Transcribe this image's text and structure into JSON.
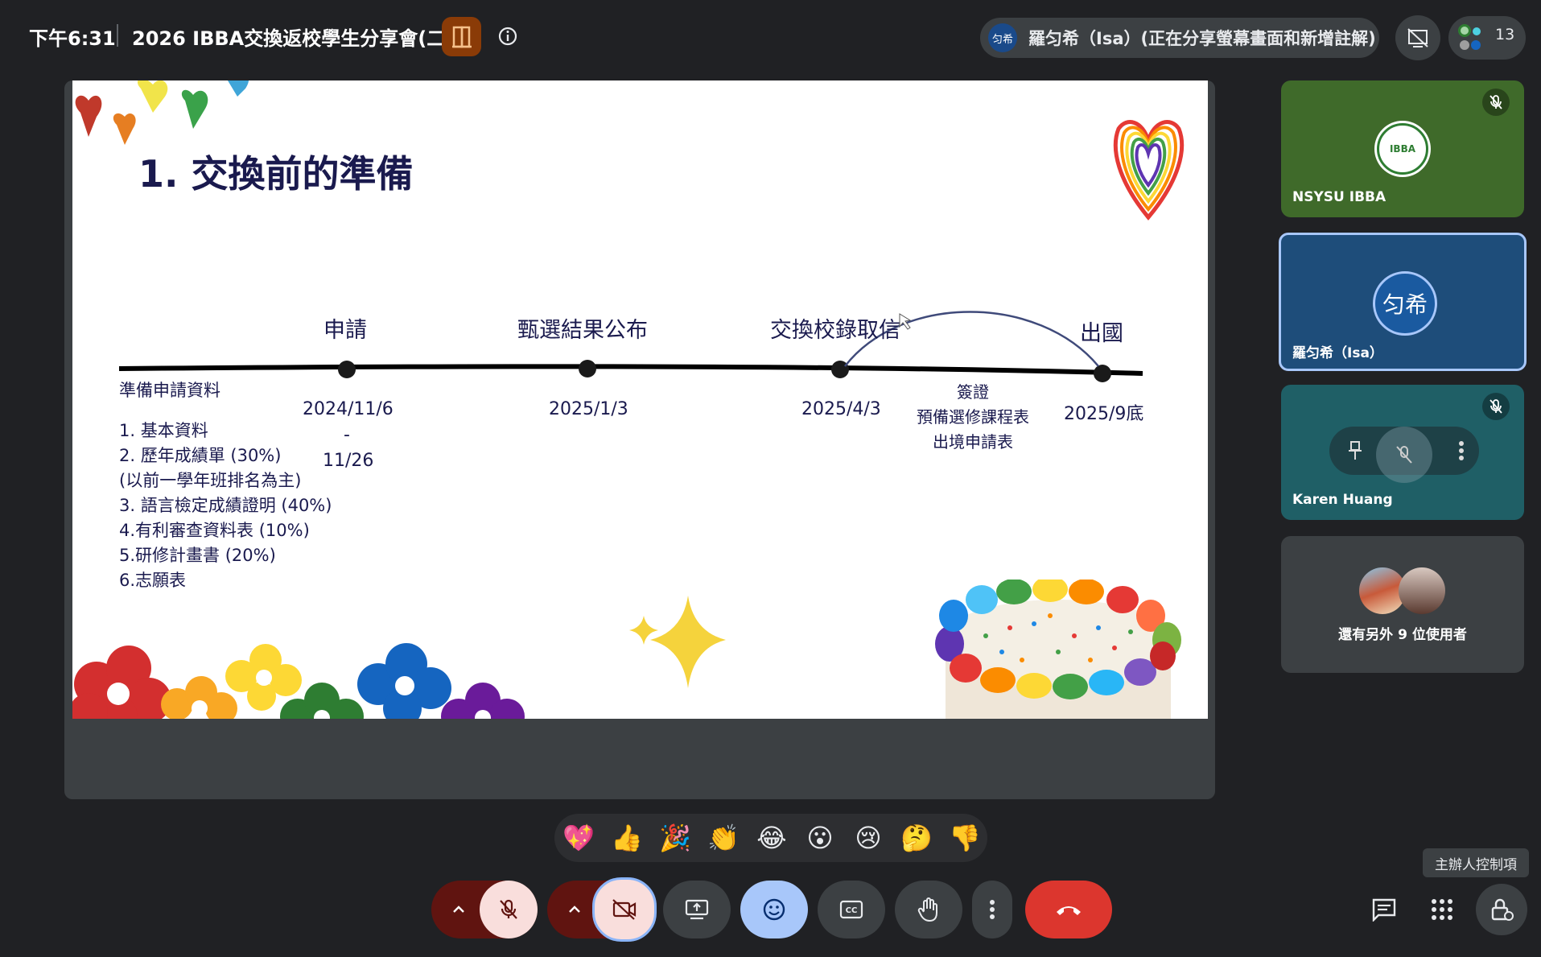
{
  "topbar": {
    "time": "下午6:31",
    "meeting_title": "2026 IBBA交換返校學生分享會(二)",
    "presenter_avatar": "匀希",
    "presenter_text": "羅匀希（Isa）(正在分享螢幕畫面和新增註解)",
    "participant_count": "13"
  },
  "slide": {
    "title": "1.  交換前的準備",
    "milestones": [
      {
        "label": "申請",
        "date": "2024/11/6"
      },
      {
        "label": "甄選結果公布",
        "date": "2025/1/3"
      },
      {
        "label": "交換校錄取信",
        "date": "2025/4/3"
      },
      {
        "label": "出國",
        "date": "2025/9底"
      }
    ],
    "date_range_dash": "-",
    "date_range_end": "11/26",
    "between_notes": [
      "簽證",
      "預備選修課程表",
      "出境申請表"
    ],
    "requirements_header": "準備申請資料",
    "requirements": [
      "1. 基本資料",
      "2. 歷年成績單 (30%)",
      "(以前一學年班排名為主)",
      "3. 語言檢定成績證明 (40%)",
      "4.有利審查資料表 (10%)",
      "5.研修計畫書 (20%)",
      "6.志願表"
    ],
    "badge_text": "IBBA"
  },
  "tiles": [
    {
      "name": "NSYSU IBBA",
      "color": "#3f6a2a"
    },
    {
      "name": "羅匀希（Isa）",
      "avatar": "匀希",
      "color": "#1e4d7a"
    },
    {
      "name": "Karen Huang",
      "color": "#1f5f66"
    },
    {
      "name": "還有另外 9 位使用者",
      "color": "#3c4043"
    }
  ],
  "reactions": [
    "💖",
    "👍",
    "🎉",
    "👏",
    "😂",
    "😮",
    "😢",
    "🤔",
    "👎"
  ],
  "host_controls_tooltip": "主辦人控制項",
  "icons": [
    "room-icon",
    "info-icon",
    "presentation-off-icon",
    "people-icon",
    "mic-off-icon",
    "camera-off-icon",
    "present-icon",
    "emoji-icon",
    "captions-icon",
    "raise-hand-icon",
    "more-options-icon",
    "end-call-icon",
    "chat-icon",
    "activities-icon",
    "host-controls-icon",
    "pin-icon",
    "chevron-up-icon"
  ]
}
